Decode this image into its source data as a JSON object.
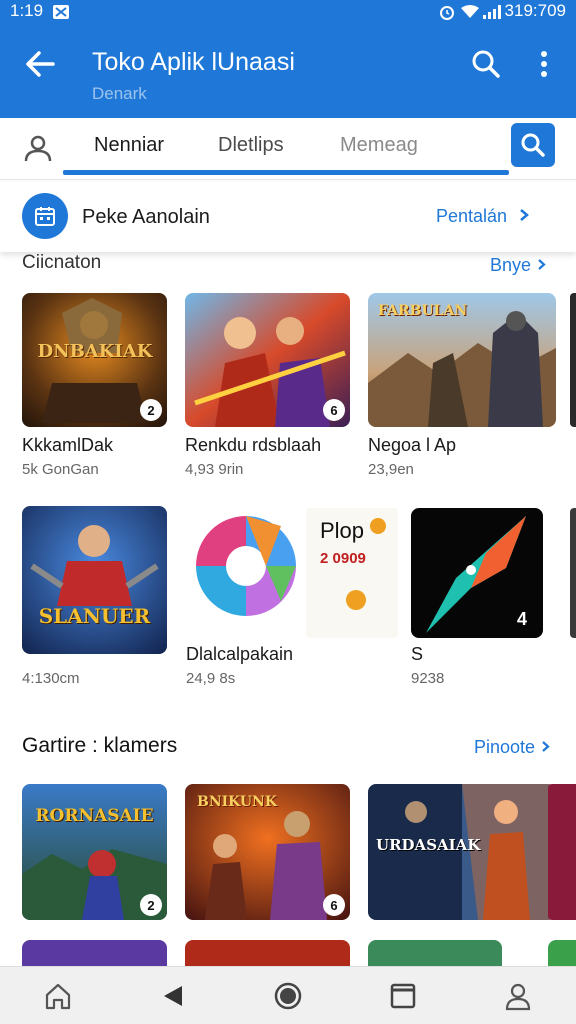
{
  "status_bar": {
    "time": "1:19",
    "right_text": "319:709"
  },
  "app_bar": {
    "title": "Toko Aplik lUnaasi",
    "subtitle": "Denark"
  },
  "tabs": [
    {
      "label": "Nenniar",
      "active": true
    },
    {
      "label": "Dletlips",
      "active": false
    },
    {
      "label": "Memeag",
      "active": false
    }
  ],
  "promo": {
    "text": "Peke Aanolain",
    "action": "Pentalán"
  },
  "section1": {
    "title": "Ciicnaton",
    "more": "Bnye",
    "apps": [
      {
        "title": "KkkamlDak",
        "sub": "5k GonGan",
        "thumb_text": "DNBAKIAK",
        "badge": "2"
      },
      {
        "title": "Renkdu rdsblaah",
        "sub": "4,93 9rin",
        "thumb_text": "",
        "badge": "6"
      },
      {
        "title": "Negoa l Ap",
        "sub": "23,9en",
        "thumb_text": "FARBULAN",
        "badge": ""
      }
    ]
  },
  "section2": {
    "apps": [
      {
        "title": "",
        "sub": "4:130cm",
        "thumb_text": "SLANUER",
        "badge": ""
      },
      {
        "title": "Dlalcalpakain",
        "sub": "24,9 8s",
        "thumb_text": "",
        "badge": ""
      },
      {
        "title": "",
        "sub": "",
        "thumb_text": "Plop",
        "price": "2 0909"
      },
      {
        "title": "S",
        "sub": "9238",
        "thumb_text": "",
        "badge": "4"
      }
    ]
  },
  "section3": {
    "title": "Gartire : klamers",
    "more": "Pinoote",
    "apps": [
      {
        "thumb_text": "RORNASAIE",
        "badge": "2"
      },
      {
        "thumb_text": "BNIKUNK",
        "badge": "6"
      },
      {
        "thumb_text": "URDASAIAK",
        "badge": ""
      }
    ]
  },
  "colors": {
    "primary": "#1f78d8",
    "background": "#ffffff",
    "nav_bg": "#f0f0f0"
  },
  "icons": {
    "app_bar": [
      "back-arrow-icon",
      "search-icon",
      "more-vert-icon"
    ],
    "bottom_nav": [
      "home-icon",
      "back-triangle-icon",
      "circle-home-icon",
      "recents-square-icon",
      "profile-icon"
    ]
  }
}
